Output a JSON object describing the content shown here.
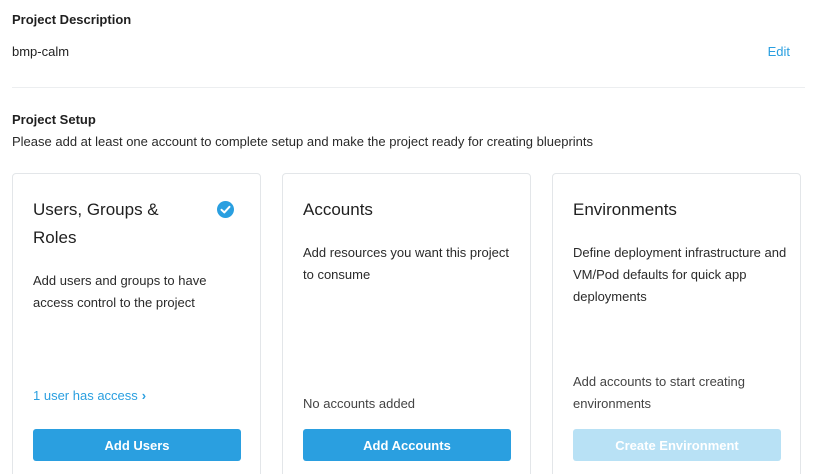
{
  "description": {
    "heading": "Project Description",
    "value": "bmp-calm",
    "edit_label": "Edit"
  },
  "setup": {
    "heading": "Project Setup",
    "subtitle": "Please add at least one account to complete setup and make the project ready for creating blueprints"
  },
  "cards": {
    "users": {
      "title": "Users, Groups & Roles",
      "description": "Add users and groups to have access control to the project",
      "access_link": "1 user has access",
      "button_label": "Add Users",
      "completed": true
    },
    "accounts": {
      "title": "Accounts",
      "description": "Add resources you want this project to consume",
      "status": "No accounts added",
      "button_label": "Add Accounts"
    },
    "environments": {
      "title": "Environments",
      "description": "Define deployment infrastructure and VM/Pod defaults for quick app deployments",
      "status": "Add accounts to start creating environments",
      "button_label": "Create Environment",
      "button_disabled": true
    }
  },
  "colors": {
    "accent": "#2a9fe0",
    "disabled_button": "#b8e1f5"
  }
}
